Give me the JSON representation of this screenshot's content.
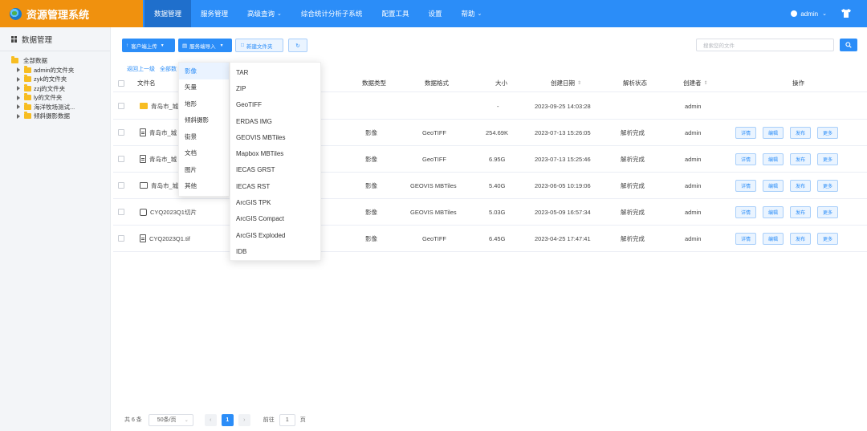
{
  "app": {
    "title": "资源管理系统"
  },
  "nav": [
    {
      "label": "数据管理",
      "active": true,
      "caret": false
    },
    {
      "label": "服务管理",
      "active": false,
      "caret": false
    },
    {
      "label": "高级查询",
      "active": false,
      "caret": true
    },
    {
      "label": "综合统计分析子系统",
      "active": false,
      "caret": false
    },
    {
      "label": "配置工具",
      "active": false,
      "caret": false
    },
    {
      "label": "设置",
      "active": false,
      "caret": false
    },
    {
      "label": "帮助",
      "active": false,
      "caret": true
    }
  ],
  "user": {
    "name": "admin"
  },
  "sidebar": {
    "title": "数据管理",
    "tree": [
      {
        "label": "全部数据",
        "root": true
      },
      {
        "label": "admin的文件夹",
        "root": false
      },
      {
        "label": "zyk的文件夹",
        "root": false
      },
      {
        "label": "zzj的文件夹",
        "root": false
      },
      {
        "label": "ly的文件夹",
        "root": false
      },
      {
        "label": "海洋牧场测试...",
        "root": false
      },
      {
        "label": "倾斜摄影数据",
        "root": false
      }
    ]
  },
  "toolbar": {
    "client_upload": "客户端上传",
    "server_import": "服务端导入",
    "new_folder": "新建文件夹",
    "refresh_icon": "refresh-icon",
    "search_placeholder": "搜索您的文件"
  },
  "breadcrumb": {
    "back": "返回上一级",
    "all": "全部数"
  },
  "table": {
    "headers": {
      "name": "文件名",
      "data_type": "数据类型",
      "data_format": "数据格式",
      "size": "大小",
      "created": "创建日期",
      "parse_status": "解析状态",
      "creator": "创建者",
      "actions": "操作"
    },
    "rows": [
      {
        "icon": "folder",
        "name": "青岛市_城",
        "type": "",
        "format": "",
        "size": "-",
        "date": "2023-09-25 14:03:28",
        "status": "",
        "creator": "admin",
        "ops": false
      },
      {
        "icon": "doc",
        "name": "青岛市_城",
        "type": "影像",
        "format": "GeoTIFF",
        "size": "254.69K",
        "date": "2023-07-13 15:26:05",
        "status": "解析完成",
        "creator": "admin",
        "ops": true
      },
      {
        "icon": "doc",
        "name": "青岛市_城",
        "type": "影像",
        "format": "GeoTIFF",
        "size": "6.95G",
        "date": "2023-07-13 15:25:46",
        "status": "解析完成",
        "creator": "admin",
        "ops": true
      },
      {
        "icon": "foldout",
        "name": "青岛市_城",
        "type": "影像",
        "format": "GEOVIS MBTiles",
        "size": "5.40G",
        "date": "2023-06-05 10:19:06",
        "status": "解析完成",
        "creator": "admin",
        "ops": true
      },
      {
        "icon": "slice",
        "name": "CYQ2023Q1切片",
        "type": "影像",
        "format": "GEOVIS MBTiles",
        "size": "5.03G",
        "date": "2023-05-09 16:57:34",
        "status": "解析完成",
        "creator": "admin",
        "ops": true
      },
      {
        "icon": "doc",
        "name": "CYQ2023Q1.tif",
        "type": "影像",
        "format": "GeoTIFF",
        "size": "6.45G",
        "date": "2023-04-25 17:47:41",
        "status": "解析完成",
        "creator": "admin",
        "ops": true
      }
    ],
    "row_actions": {
      "detail": "详情",
      "edit": "编辑",
      "publish": "发布",
      "more": "更多"
    }
  },
  "menu_categories": [
    "影像",
    "矢量",
    "地形",
    "倾斜摄影",
    "街景",
    "文档",
    "图片",
    "其他"
  ],
  "menu_formats": [
    "TAR",
    "ZIP",
    "GeoTIFF",
    "ERDAS IMG",
    "GEOVIS MBTiles",
    "Mapbox MBTiles",
    "IECAS GRST",
    "IECAS RST",
    "ArcGIS TPK",
    "ArcGIS Compact",
    "ArcGIS Exploded",
    "IDB"
  ],
  "pagination": {
    "total": "共 6 条",
    "page_size": "50条/页",
    "current": "1",
    "goto_label": "前往",
    "goto_value": "1",
    "page_unit": "页"
  }
}
